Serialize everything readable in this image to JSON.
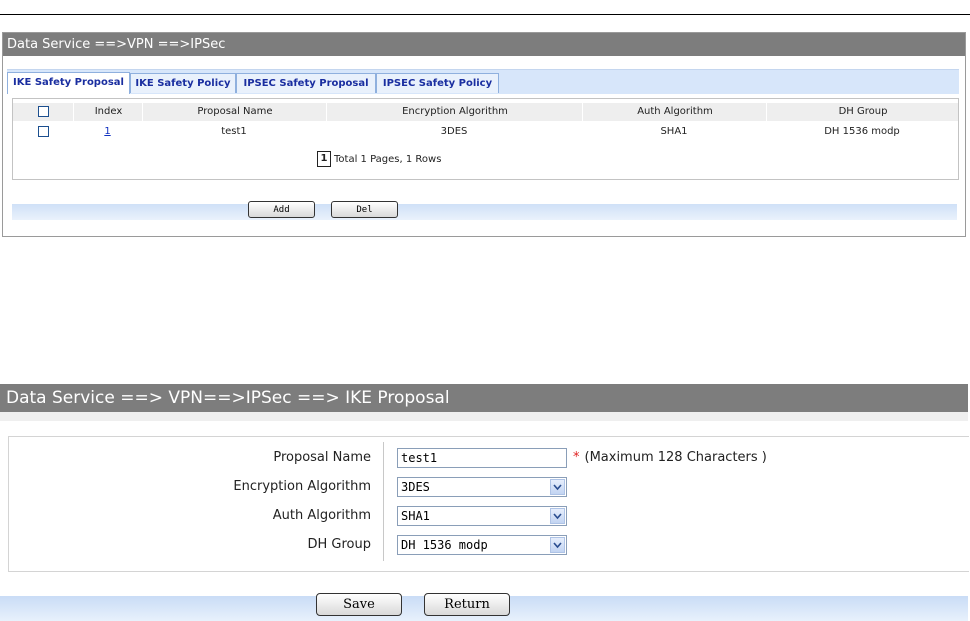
{
  "list_panel": {
    "breadcrumb": "Data Service ==>VPN ==>IPSec",
    "tabs": [
      {
        "label": "IKE Safety Proposal",
        "active": true
      },
      {
        "label": "IKE Safety Policy",
        "active": false
      },
      {
        "label": "IPSEC Safety Proposal",
        "active": false
      },
      {
        "label": "IPSEC Safety Policy",
        "active": false
      }
    ],
    "table": {
      "headers": [
        "Index",
        "Proposal Name",
        "Encryption Algorithm",
        "Auth Algorithm",
        "DH Group"
      ],
      "rows": [
        {
          "checked": false,
          "index": "1",
          "proposal_name": "test1",
          "encryption": "3DES",
          "auth": "SHA1",
          "dh_group": "DH 1536 modp"
        }
      ]
    },
    "pager": {
      "current_page": "1",
      "summary": "Total 1 Pages, 1 Rows"
    },
    "buttons": {
      "add": "Add",
      "del": "Del"
    }
  },
  "form_panel": {
    "breadcrumb": "Data Service ==> VPN==>IPSec ==> IKE Proposal",
    "fields": {
      "proposal_name": {
        "label": "Proposal Name",
        "value": "test1",
        "hint_star": "*",
        "hint": "(Maximum 128 Characters )"
      },
      "encryption": {
        "label": "Encryption Algorithm",
        "value": "3DES"
      },
      "auth": {
        "label": "Auth Algorithm",
        "value": "SHA1"
      },
      "dh_group": {
        "label": "DH Group",
        "value": "DH 1536 modp"
      }
    },
    "buttons": {
      "save": "Save",
      "return": "Return"
    }
  },
  "colors": {
    "title_bar": "#7d7d7d",
    "tab_bar": "#d7e6fa",
    "link": "#1030c0",
    "required_star": "#e02020"
  }
}
